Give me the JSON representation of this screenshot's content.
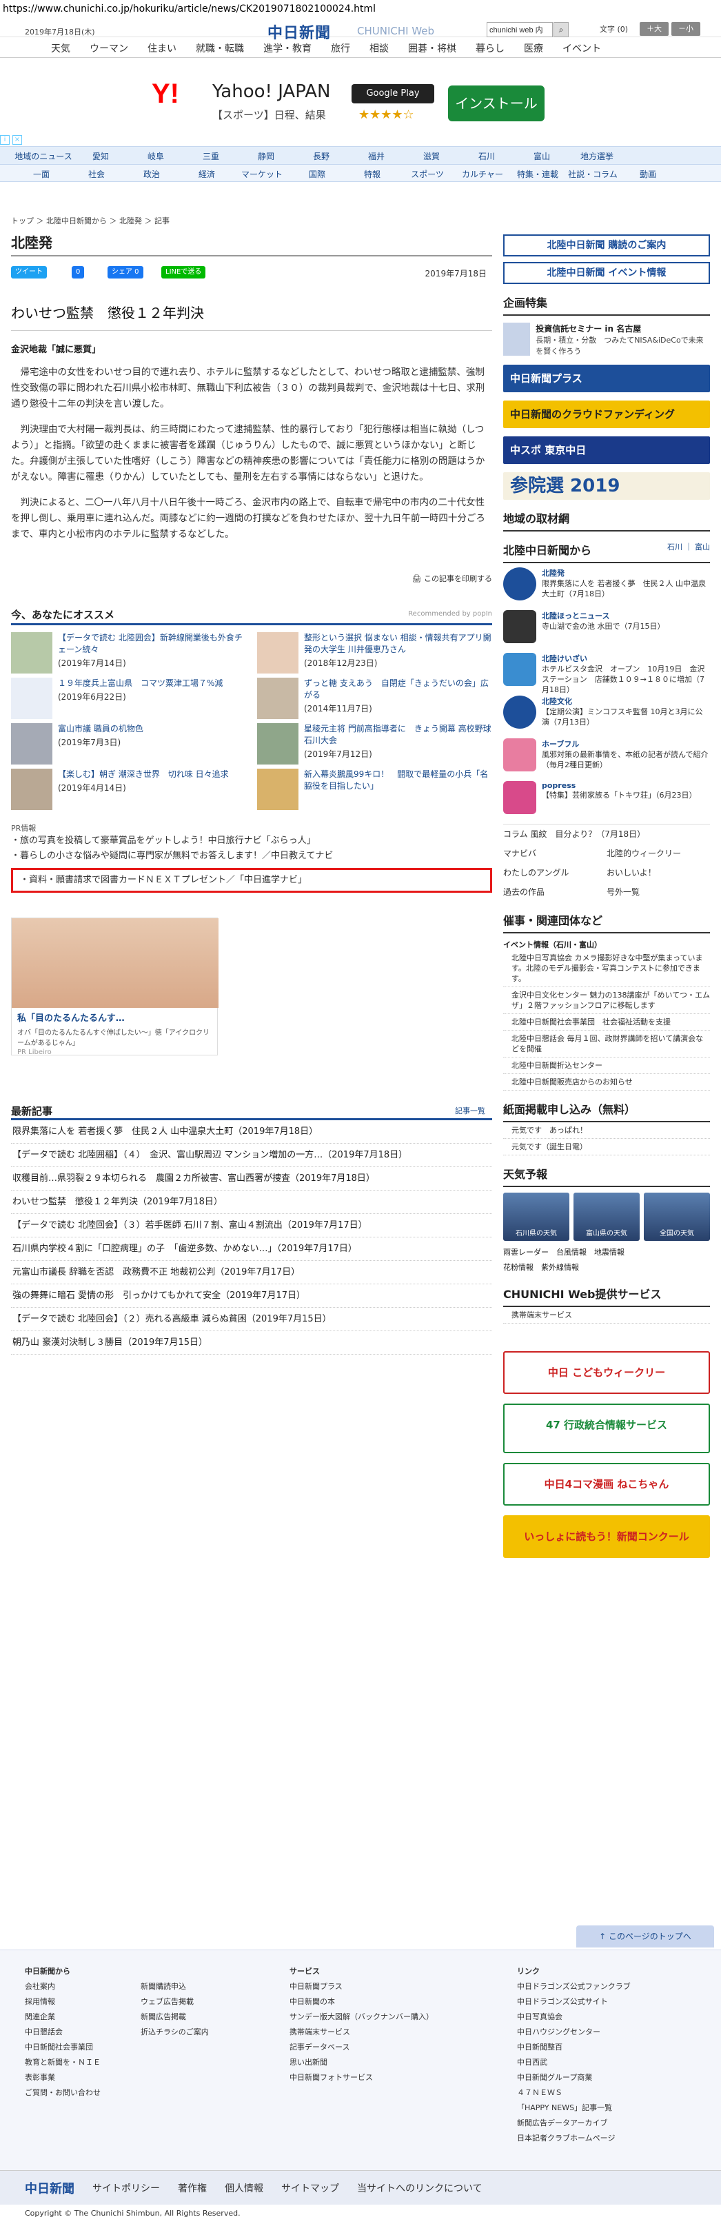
{
  "browser": {
    "url": "https://www.chunichi.co.jp/hokuriku/article/news/CK2019071802100024.html"
  },
  "header": {
    "date": "2019年7月18日(木)",
    "logo": "中日新聞",
    "logo_en": "CHUNICHI Web",
    "search_value": "chunichi web 内",
    "font_label": "文字 (0)",
    "font_inc": "＋大",
    "font_dec": "－小"
  },
  "global_nav": [
    "天気",
    "ウーマン",
    "住まい",
    "就職・転職",
    "進学・教育",
    "旅行",
    "相談",
    "囲碁・将棋",
    "暮らし",
    "医療",
    "イベント"
  ],
  "ad": {
    "brand": "Y!",
    "brand_name": "Yahoo! JAPAN",
    "sub": "【スポーツ】日程、結果",
    "store": "Google Play",
    "stars": "★★★★☆",
    "install": "インストール"
  },
  "region_nav": [
    "地域のニュース",
    "愛知",
    "岐阜",
    "三重",
    "静岡",
    "長野",
    "福井",
    "滋賀",
    "石川",
    "富山",
    "地方選挙"
  ],
  "cat_nav": [
    "一面",
    "社会",
    "政治",
    "経済",
    "マーケット",
    "国際",
    "特報",
    "スポーツ",
    "カルチャー",
    "特集・連載",
    "社説・コラム",
    "動画"
  ],
  "breadcrumb": "トップ ＞ 北陸中日新聞から ＞ 北陸発 ＞ 記事",
  "section_title": "北陸発",
  "share": {
    "tweet": "ツイート",
    "like": "0",
    "share": "シェア 0",
    "line": "LINEで送る"
  },
  "article": {
    "date": "2019年7月18日",
    "title": "わいせつ監禁　懲役１２年判決",
    "dateline": "金沢地裁「誠に悪質」",
    "paragraphs": [
      "　帰宅途中の女性をわいせつ目的で連れ去り、ホテルに監禁するなどしたとして、わいせつ略取と逮捕監禁、強制性交致傷の罪に問われた石川県小松市林町、無職山下利広被告（３０）の裁判員裁判で、金沢地裁は十七日、求刑通り懲役十二年の判決を言い渡した。",
      "　判決理由で大村陽一裁判長は、約三時間にわたって逮捕監禁、性的暴行しており「犯行態様は相当に執拗（しつよう）」と指摘。「欲望の赴くままに被害者を蹂躙（じゅうりん）したもので、誠に悪質というほかない」と断じた。弁護側が主張していた性嗜好（しこう）障害などの精神疾患の影響については「責任能力に格別の問題はうかがえない。障害に罹患（りかん）していたとしても、量刑を左右する事情にはならない」と退けた。",
      "　判決によると、二〇一八年八月十八日午後十一時ごろ、金沢市内の路上で、自転車で帰宅中の市内の二十代女性を押し倒し、乗用車に連れ込んだ。両膝などに約一週間の打撲などを負わせたほか、翌十九日午前一時四十分ごろまで、車内と小松市内のホテルに監禁するなどした。"
    ],
    "print": "この記事を印刷する"
  },
  "reco": {
    "title": "今、あなたにオススメ",
    "powered": "Recommended by popIn",
    "items": [
      {
        "title": "【データで読む 北陸囲会】新幹線開業後も外食チェーン続々",
        "date": "(2019年7月14日)"
      },
      {
        "title": "整形という選択 悩まない 相談・情報共有アプリ開発の大学生 川井優恵乃さん",
        "date": "(2018年12月23日)"
      },
      {
        "title": "１９年度兵上富山県　コマツ粟津工場７%減",
        "date": "(2019年6月22日)"
      },
      {
        "title": "ずっと糖 支えあう　自閉症「きょうだいの会」広がる",
        "date": "(2014年11月7日)"
      },
      {
        "title": "富山市議 職員の机物色",
        "date": "(2019年7月3日)"
      },
      {
        "title": "星稜元主将 門前高指導者に　きょう開幕 高校野球石川大会",
        "date": "(2019年7月12日)"
      },
      {
        "title": "【楽しむ】朝ぎ 潮深き世界　切れ味 日々追求",
        "date": "(2019年4月14日)"
      },
      {
        "title": "新入幕炎鵬風99キロ！　闘取で最軽量の小兵「名脇役を目指したい」",
        "date": ""
      }
    ]
  },
  "pr": {
    "label": "PR情報",
    "links": [
      "旅の写真を投稿して豪華賞品をゲットしよう！中日旅行ナビ「ぶらっ人」",
      "暮らしの小さな悩みや疑問に専門家が無料でお答えします！／中日教えてナビ"
    ],
    "highlight": "資料・願書請求で図書カードＮＥＸＴプレゼント／「中日進学ナビ」",
    "card_title": "私「目のたるんたるんす…",
    "card_sub": "オバ「目のたるんたるんすぐ伸ばしたい〜」徳「アイクロクリームがあるじゃん」",
    "card_src": "PR Libeiro"
  },
  "latest": {
    "title": "最新記事",
    "more": "記事一覧",
    "items": [
      "限界集落に人を 若者援く夢　住民２人 山中温泉大土町（2019年7月18日）",
      "【データで読む 北陸囲稲】（４）　金沢、富山駅周辺 マンション増加の一方…（2019年7月18日）",
      "収穫目前…県羽裂２９本切られる　農園２カ所被害、富山西署が捜査（2019年7月18日）",
      "わいせつ監禁　懲役１２年判決（2019年7月18日）",
      "【データで読む 北陸回会】（３）若手医師 石川７割、富山４割流出（2019年7月17日）",
      "石川県内学校４割に「口腔病理」の子　「歯逆多数、かめない…」（2019年7月17日）",
      "元富山市議長 辞職を否認　政務費不正 地裁初公判（2019年7月17日）",
      "強の舞舞に暗石 愛情の形　引っかけてもかれて安全（2019年7月17日）",
      "【データで読む 北陸回会】（２）売れる高級車 減らぬ貧困（2019年7月15日）",
      "朝乃山 豪漢対決制し３勝目（2019年7月15日）"
    ]
  },
  "side": {
    "btn1": "北陸中日新聞 購読のご案内",
    "btn2": "北陸中日新聞 イベント情報",
    "plan_h": "企画特集",
    "plan_item": "投資信託セミナー in 名古屋",
    "plan_sub": "長期・積立・分散　つみたてNISA&iDeCoで未来を賢く作ろう",
    "banner1": "中日新聞プラス",
    "banner2": "中日新聞のクラウドファンディング",
    "banner3": "中スポ 東京中日",
    "banner4": "参院選 2019",
    "local_h": "地域の取材網",
    "from_h": "北陸中日新聞から",
    "from_tabs": "石川 ｜ 富山",
    "from_items": [
      {
        "t": "北陸発",
        "s": "限界集落に人を 若者援く夢　住民２人 山中温泉大土町（7月18日）"
      },
      {
        "t": "北陸ほっとニュース",
        "s": "寺山湖で金の池 水田で（7月15日）"
      },
      {
        "t": "北陸けいざい",
        "s": "ホテルビスタ金沢　オープン　10月19日　金沢ステーション　店舗数１０９→１８０に増加（7月18日）"
      },
      {
        "t": "北陸文化",
        "s": "【定期公演】ミンコフスキ監督 10月と3月に公演（7月13日）"
      },
      {
        "t": "ホーブフル",
        "s": "風邪対策の最新事情を、本紙の記者が読んで紹介（毎月2種日更新）"
      },
      {
        "t": "popress",
        "s": "【特集】芸術家族る「トキワ荘」（6月23日）"
      }
    ],
    "links": [
      "コラム 風紋　目分より？（7月18日）",
      "マナビバ",
      "北陸的ウィークリー",
      "わたしのアングル",
      "おいしいよ！",
      "過去の作品",
      "号外一覧"
    ],
    "event_h": "催事・関連団体など",
    "event_sub": "イベント情報（石川・富山）",
    "events": [
      "北陸中日写真協会 カメラ撮影好きな中堅が集まっています。北陸のモデル撮影会・写真コンテストに参加できます。",
      "金沢中日文化センター 魅力の138講座が「めいてつ・エムザ」２階ファッションフロアに移転します",
      "北陸中日新聞社会事業団　社会福祉活動を支援",
      "北陸中日懇話会 毎月１回、政財界講師を招いて講演会などを開催",
      "北陸中日新聞折込センター",
      "北陸中日新聞販売店からのお知らせ"
    ],
    "paper_h": "紙面掲載申し込み（無料）",
    "paper": [
      "元気です　あっぱれ！",
      "元気です（誕生日電）"
    ],
    "weather_h": "天気予報",
    "weather": [
      "石川県の天気",
      "富山県の天気",
      "全国の天気"
    ],
    "weather_links": [
      "雨雲レーダー",
      "台風情報",
      "地震情報",
      "花粉情報",
      "紫外線情報"
    ],
    "service_h": "CHUNICHI Web提供サービス",
    "service": "携帯端末サービス",
    "ad1": "中日 こどもウィークリー",
    "ad2": "47 行政統合情報サービス",
    "ad3": "中日4コマ漫画 ねこちゃん",
    "ad4": "いっしょに読もう！新聞コンクール"
  },
  "to_top": "このページのトップへ",
  "footer": {
    "col1_h": "中日新聞から",
    "col1": [
      "会社案内",
      "採用情報",
      "関連企業",
      "中日懇話会",
      "中日新聞社会事業団",
      "教育と新聞を・ＮＩＥ",
      "表彰事業",
      "ご質問・お問い合わせ"
    ],
    "col2": [
      "新聞購読申込",
      "ウェブ広告掲載",
      "新聞広告掲載",
      "折込チラシのご案内"
    ],
    "col3_h": "サービス",
    "col3": [
      "中日新聞プラス",
      "中日新聞の本",
      "サンデー版大図解（バックナンバー購入）",
      "携帯端末サービス",
      "記事データベース",
      "思い出新聞",
      "中日新聞フォトサービス"
    ],
    "col4_h": "リンク",
    "col4": [
      "中日ドラゴンズ公式ファンクラブ",
      "中日ドラゴンズ公式サイト",
      "中日写真協会",
      "中日ハウジングセンター",
      "中日新聞整百",
      "中日西武",
      "中日新聞グループ商業",
      "４７ＮＥＷＳ",
      "「HAPPY NEWS」記事一覧",
      "新聞広告データアーカイブ",
      "日本記者クラブホームページ"
    ],
    "bar": [
      "中日新聞",
      "サイトポリシー",
      "著作権",
      "個人情報",
      "サイトマップ",
      "当サイトへのリンクについて"
    ],
    "copyright": "Copyright © The Chunichi Shimbun, All Rights Reserved."
  }
}
